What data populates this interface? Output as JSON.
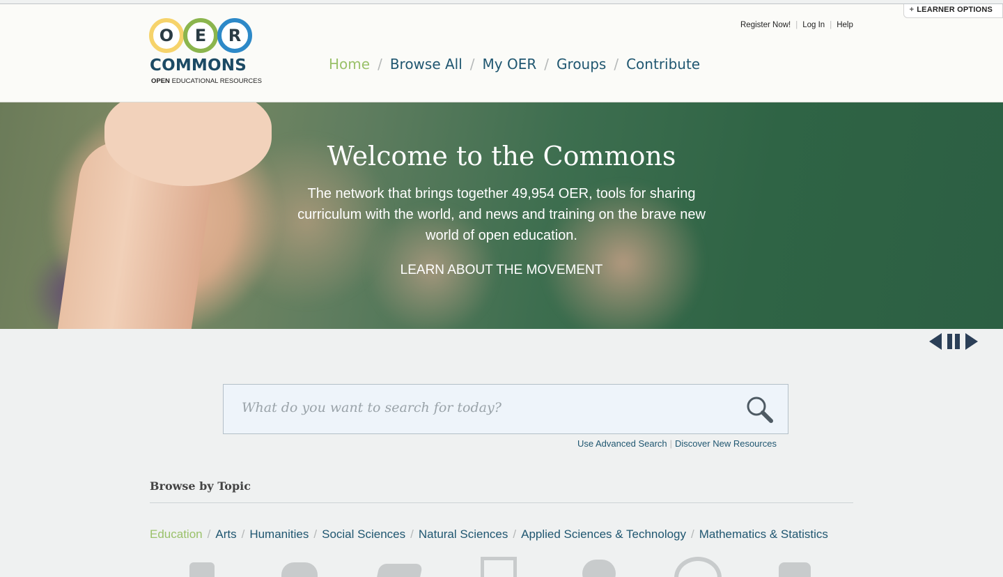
{
  "header": {
    "learner_options": "LEARNER OPTIONS",
    "logo": {
      "letters": [
        "O",
        "E",
        "R"
      ],
      "name": "COMMONS",
      "tagline_bold": "OPEN",
      "tagline_rest": " EDUCATIONAL RESOURCES"
    },
    "util_links": [
      "Register Now!",
      "Log In",
      "Help"
    ],
    "nav": [
      "Home",
      "Browse All",
      "My OER",
      "Groups",
      "Contribute"
    ]
  },
  "hero": {
    "title": "Welcome to the Commons",
    "subtitle": "The network that brings together 49,954 OER, tools for sharing curriculum with the world, and news and training on the brave new world of open education.",
    "cta": "LEARN ABOUT THE MOVEMENT"
  },
  "search": {
    "placeholder": "What do you want to search for today?",
    "links": [
      "Use Advanced Search",
      "Discover New Resources"
    ]
  },
  "browse": {
    "title": "Browse by Topic",
    "topics": [
      "Education",
      "Arts",
      "Humanities",
      "Social Sciences",
      "Natural Sciences",
      "Applied Sciences & Technology",
      "Mathematics & Statistics"
    ]
  },
  "colors": {
    "brand_dark": "#1c4a64",
    "link": "#1f5670",
    "active": "#9ac16a",
    "ring_yellow": "#f6d36b",
    "ring_green": "#8bb54d",
    "ring_blue": "#2d89c8"
  }
}
